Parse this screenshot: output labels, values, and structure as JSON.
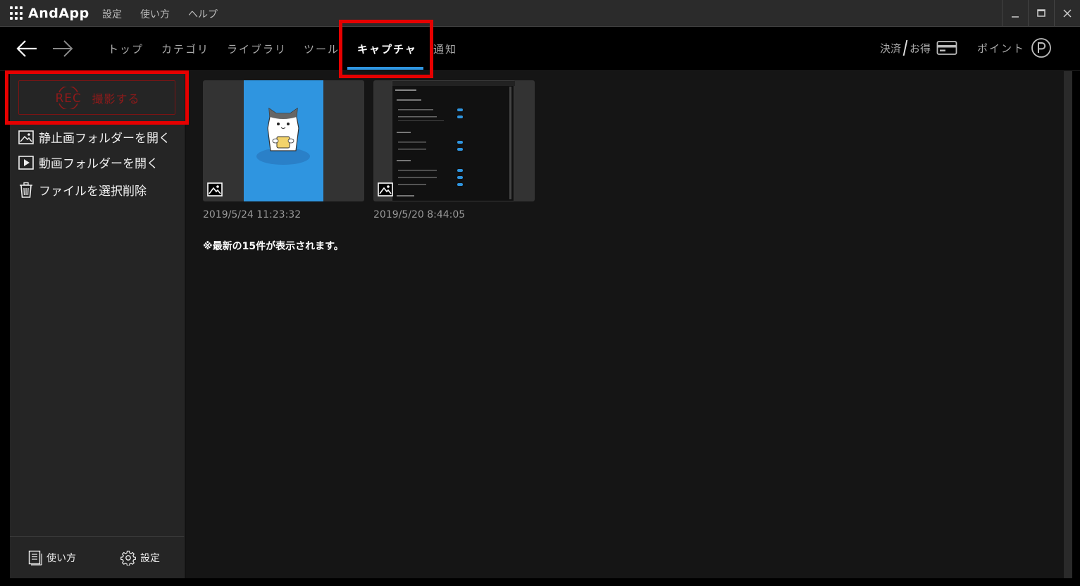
{
  "titlebar": {
    "app_name": "AndApp",
    "menu": [
      "設定",
      "使い方",
      "ヘルプ"
    ],
    "controls": {
      "minimize": "_",
      "maximize": "□",
      "close": "✕"
    }
  },
  "nav": {
    "tabs": [
      {
        "label": "トップ",
        "active": false
      },
      {
        "label": "カテゴリ",
        "active": false
      },
      {
        "label": "ライブラリ",
        "active": false
      },
      {
        "label": "ツール",
        "active": false
      },
      {
        "label": "キャプチャ",
        "active": true
      },
      {
        "label": "通知",
        "active": false
      }
    ],
    "payment": {
      "left": "決済",
      "right": "お得"
    },
    "points_label": "ポイント",
    "accent_color": "#2f95e0"
  },
  "sidebar": {
    "rec_logo_text": "REC",
    "rec_label": "撮影する",
    "items": [
      {
        "label": "静止画フォルダーを開く",
        "icon": "image-folder-icon"
      },
      {
        "label": "動画フォルダーを開く",
        "icon": "video-folder-icon"
      },
      {
        "label": "ファイルを選択削除",
        "icon": "trash-icon"
      }
    ],
    "footer": {
      "help_label": "使い方",
      "settings_label": "設定"
    }
  },
  "main": {
    "captures": [
      {
        "date": "2019/5/24 11:23:32",
        "type": "image"
      },
      {
        "date": "2019/5/20 8:44:05",
        "type": "image"
      }
    ],
    "note": "※最新の15件が表示されます。"
  },
  "highlight_color": "#e60000"
}
